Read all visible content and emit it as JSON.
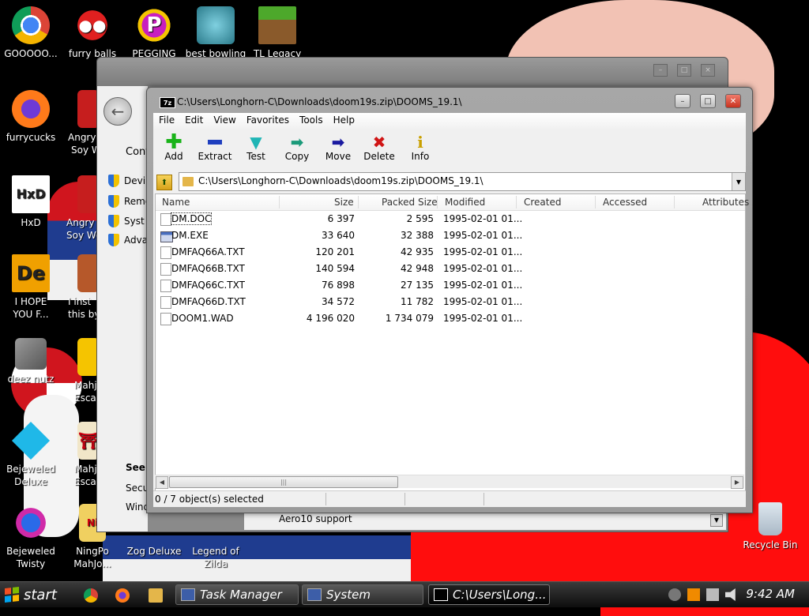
{
  "desktop": {
    "icons": [
      {
        "label": "GOOOOO...",
        "icon": "chrome-icon"
      },
      {
        "label": "furry balls",
        "icon": "furry-balls-icon"
      },
      {
        "label": "PEGGING",
        "icon": "pegging-icon"
      },
      {
        "label": "best bowling",
        "icon": "bowling-icon"
      },
      {
        "label": "TL Legacy",
        "icon": "minecraft-block-icon"
      },
      {
        "label": "furrycucks",
        "icon": "firefox-icon"
      },
      {
        "label": "Angry I",
        "label2": "Soy W",
        "icon": "angry-birds-icon"
      },
      {
        "label": "HxD",
        "icon": "hxd-icon"
      },
      {
        "label": "Angry I",
        "label2": "Soy Wo",
        "icon": "angry-birds-icon-2"
      },
      {
        "label": "I HOPE",
        "label2": "YOU F...",
        "icon": "de-icon"
      },
      {
        "label": "I inst",
        "label2": "this by",
        "icon": "character-icon"
      },
      {
        "label": "deez nutz",
        "icon": "shortcut-copies-icon"
      },
      {
        "label": "Mahj",
        "label2": "Esca",
        "icon": "mahjong-icon"
      },
      {
        "label": "Bejeweled",
        "label2": "Deluxe",
        "icon": "bejeweled-gem-icon"
      },
      {
        "label": "Mahj",
        "label2": "Esca",
        "icon": "mahjong-gate-icon"
      },
      {
        "label": "Bejeweled",
        "label2": "Twisty",
        "icon": "bejeweled-twist-icon"
      },
      {
        "label": "NingPo",
        "label2": "MahJo...",
        "icon": "ningpo-mahjong-icon"
      },
      {
        "label": "Zog Deluxe",
        "icon": "zog-icon"
      },
      {
        "label": "Legend of",
        "label2": "Zilda",
        "icon": "zilda-icon"
      },
      {
        "label": "Recycle Bin",
        "icon": "recycle-bin-icon"
      }
    ]
  },
  "system_window": {
    "sidebar": [
      "Devi",
      "Remo",
      "Syst",
      "Adva"
    ],
    "control_text": "Cont",
    "see_also": "See",
    "secu": "Secu",
    "wind": "Wind",
    "aero_text": "Aero10 support"
  },
  "zip_window": {
    "title": "C:\\Users\\Longhorn-C\\Downloads\\doom19s.zip\\DOOMS_19.1\\",
    "menu": [
      "File",
      "Edit",
      "View",
      "Favorites",
      "Tools",
      "Help"
    ],
    "toolbar": [
      {
        "label": "Add",
        "icon": "add-plus-icon",
        "color": "#19b319"
      },
      {
        "label": "Extract",
        "icon": "extract-minus-icon",
        "color": "#1f3fbf"
      },
      {
        "label": "Test",
        "icon": "test-check-icon",
        "color": "#1fb5b5"
      },
      {
        "label": "Copy",
        "icon": "copy-arrow-icon",
        "color": "#1a9a7a"
      },
      {
        "label": "Move",
        "icon": "move-arrow-icon",
        "color": "#1a1aa0"
      },
      {
        "label": "Delete",
        "icon": "delete-x-icon",
        "color": "#d01515"
      },
      {
        "label": "Info",
        "icon": "info-i-icon",
        "color": "#c9a000"
      }
    ],
    "address": "C:\\Users\\Longhorn-C\\Downloads\\doom19s.zip\\DOOMS_19.1\\",
    "columns": [
      "Name",
      "Size",
      "Packed Size",
      "Modified",
      "Created",
      "Accessed",
      "Attributes"
    ],
    "files": [
      {
        "name": "DM.DOC",
        "size": "6 397",
        "packed": "2 595",
        "modified": "1995-02-01 01...",
        "type": "doc"
      },
      {
        "name": "DM.EXE",
        "size": "33 640",
        "packed": "32 388",
        "modified": "1995-02-01 01...",
        "type": "exe"
      },
      {
        "name": "DMFAQ66A.TXT",
        "size": "120 201",
        "packed": "42 935",
        "modified": "1995-02-01 01...",
        "type": "txt"
      },
      {
        "name": "DMFAQ66B.TXT",
        "size": "140 594",
        "packed": "42 948",
        "modified": "1995-02-01 01...",
        "type": "txt"
      },
      {
        "name": "DMFAQ66C.TXT",
        "size": "76 898",
        "packed": "27 135",
        "modified": "1995-02-01 01...",
        "type": "txt"
      },
      {
        "name": "DMFAQ66D.TXT",
        "size": "34 572",
        "packed": "11 782",
        "modified": "1995-02-01 01...",
        "type": "txt"
      },
      {
        "name": "DOOM1.WAD",
        "size": "4 196 020",
        "packed": "1 734 079",
        "modified": "1995-02-01 01...",
        "type": "wad"
      }
    ],
    "status": "0 / 7 object(s) selected"
  },
  "taskbar": {
    "start_label": "start",
    "quicklaunch": [
      "chrome-icon",
      "firefox-icon",
      "explorer-icon"
    ],
    "buttons": [
      {
        "label": "Task Manager",
        "active": false
      },
      {
        "label": "System",
        "active": false
      },
      {
        "label": "C:\\Users\\Long...",
        "active": true
      }
    ],
    "clock": "9:42 AM"
  }
}
